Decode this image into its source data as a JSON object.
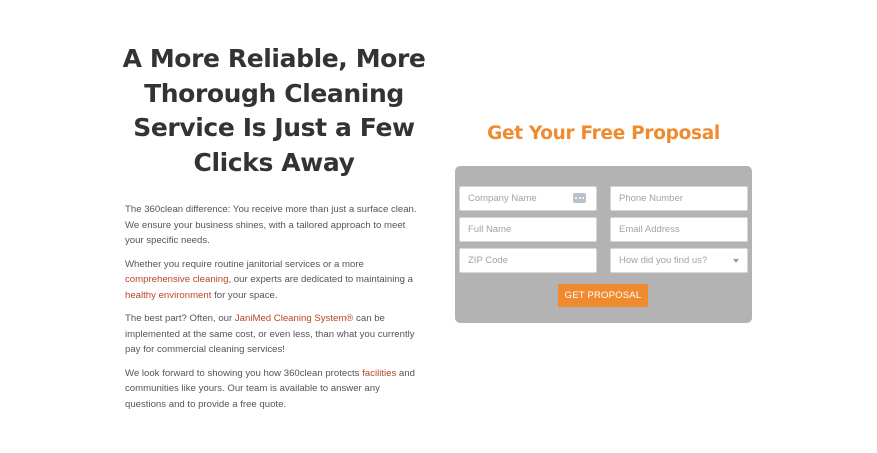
{
  "headline": "A More Reliable, More Thorough Cleaning Service Is Just a Few Clicks Away",
  "paragraphs": {
    "p1": "The 360clean difference: You receive more than just a surface clean. We ensure your business shines, with a tailored approach to meet your specific needs.",
    "p2_a": "Whether you require routine janitorial services or a more ",
    "p2_link1": "comprehensive cleaning",
    "p2_b": ", our experts are dedicated to maintaining a ",
    "p2_link2": "healthy environment",
    "p2_c": " for your space.",
    "p3_a": "The best part? Often, our ",
    "p3_link": "JaniMed Cleaning System®",
    "p3_b": " can be implemented at the same cost, or even less, than what you currently pay for commercial cleaning services!",
    "p4_a": "We look forward to showing you how 360clean protects ",
    "p4_link": "facilities",
    "p4_b": " and communities like yours. Our team is available to answer any questions and to provide a free quote."
  },
  "form": {
    "title": "Get Your Free Proposal",
    "company_placeholder": "Company Name",
    "phone_placeholder": "Phone Number",
    "name_placeholder": "Full Name",
    "email_placeholder": "Email Address",
    "zip_placeholder": "ZIP Code",
    "source_selected": "How did you find us?",
    "submit_label": "GET PROPOSAL",
    "autofill_icon": "keypad-icon"
  },
  "colors": {
    "accent": "#f08a2e",
    "link": "#b7462a",
    "panel": "#b3b3b3",
    "heading": "#333333"
  }
}
